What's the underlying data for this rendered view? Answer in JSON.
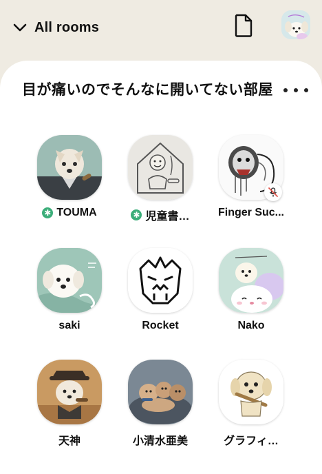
{
  "header": {
    "rooms_label": "All rooms"
  },
  "room": {
    "title": "目が痛いのでそんなに開いてない部屋"
  },
  "members": [
    {
      "name": "TOUMA",
      "online": true
    },
    {
      "name": "児童書…",
      "online": true
    },
    {
      "name": "Finger Suc...",
      "online": false,
      "muted": true
    },
    {
      "name": "saki",
      "online": false
    },
    {
      "name": "Rocket",
      "online": false
    },
    {
      "name": "Nako",
      "online": false
    },
    {
      "name": "天神",
      "online": false
    },
    {
      "name": "小清水亜美",
      "online": false
    },
    {
      "name": "グラフィ…",
      "online": false
    }
  ],
  "colors": {
    "background": "#efebe2",
    "sheet": "#ffffff",
    "online": "#3cae7a",
    "muted": "#e0534a"
  }
}
